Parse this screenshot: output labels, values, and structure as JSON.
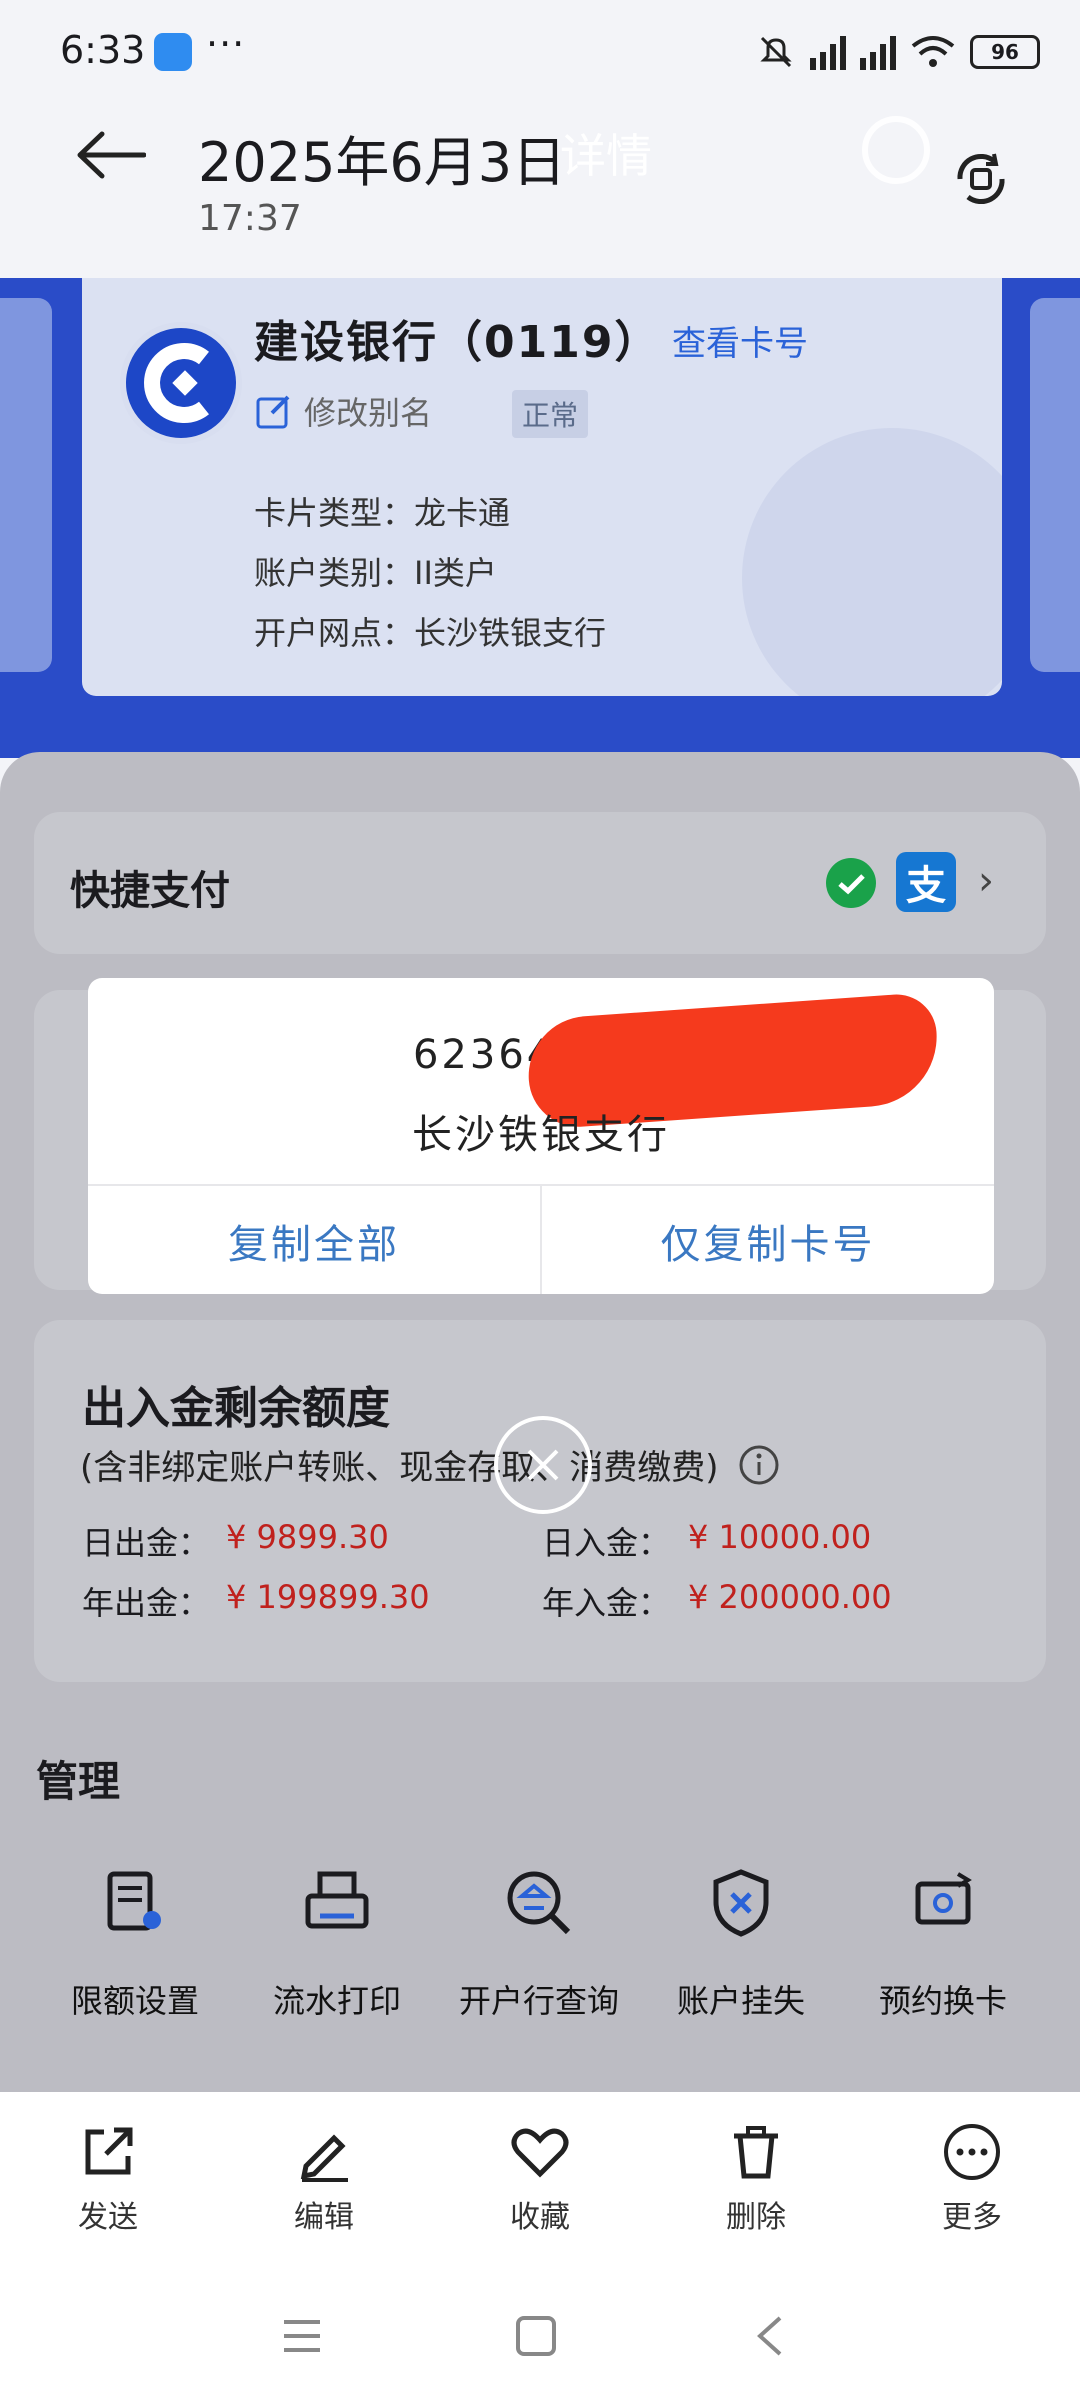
{
  "status_bar": {
    "time": "6:33",
    "more": "···",
    "battery": "96"
  },
  "header": {
    "title": "2025年6月3日",
    "subtitle": "17:37",
    "ghost_title": "详情"
  },
  "card": {
    "bank_name": "建设银行（0119）",
    "view_card": "查看卡号",
    "edit_alias": "修改别名",
    "status": "正常",
    "card_type": "卡片类型：龙卡通",
    "account_class": "账户类别：II类户",
    "branch": "开户网点：长沙铁银支行"
  },
  "quick_pay": {
    "title": "快捷支付",
    "alipay_glyph": "支"
  },
  "dialog": {
    "card_number_prefix": "623643300",
    "branch": "长沙铁银支行",
    "copy_all": "复制全部",
    "copy_number": "仅复制卡号"
  },
  "limits": {
    "title": "出入金剩余额度",
    "note": "(含非绑定账户转账、现金存取、消费缴费)",
    "daily_out_label": "日出金：",
    "daily_out_value": "¥ 9899.30",
    "daily_in_label": "日入金：",
    "daily_in_value": "¥ 10000.00",
    "yearly_out_label": "年出金：",
    "yearly_out_value": "¥ 199899.30",
    "yearly_in_label": "年入金：",
    "yearly_in_value": "¥ 200000.00"
  },
  "manage": {
    "title": "管理",
    "items": [
      "限额设置",
      "流水打印",
      "开户行查询",
      "账户挂失",
      "预约换卡"
    ]
  },
  "bottom_bar": {
    "items": [
      "发送",
      "编辑",
      "收藏",
      "删除",
      "更多"
    ]
  }
}
